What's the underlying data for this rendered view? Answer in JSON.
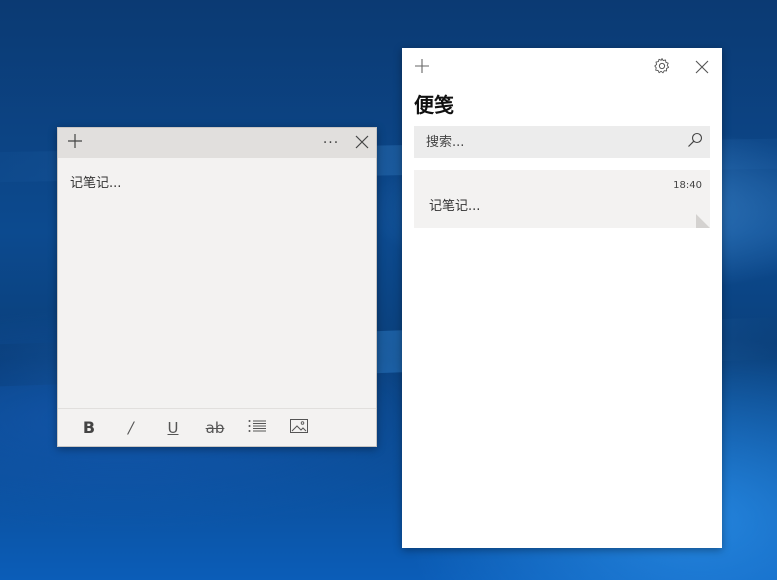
{
  "sticky_note": {
    "content": "记笔记...",
    "header": {
      "add_icon": "plus-icon",
      "more_icon": "ellipsis-icon",
      "more_glyph": "···",
      "close_icon": "close-icon"
    },
    "toolbar": {
      "bold": "B",
      "italic": "/",
      "underline": "U",
      "strikethrough": "ab",
      "list_icon": "bullet-list-icon",
      "image_icon": "image-icon"
    }
  },
  "notes_list": {
    "title": "便笺",
    "header": {
      "add_icon": "plus-icon",
      "settings_icon": "gear-icon",
      "close_icon": "close-icon"
    },
    "search": {
      "placeholder": "搜索...",
      "icon": "search-icon"
    },
    "notes": [
      {
        "time": "18:40",
        "text": "记笔记..."
      }
    ]
  },
  "colors": {
    "note_header": "#e1dfdd",
    "note_body": "#f3f2f1",
    "list_bg": "#ffffff",
    "search_bg": "#ececec"
  }
}
